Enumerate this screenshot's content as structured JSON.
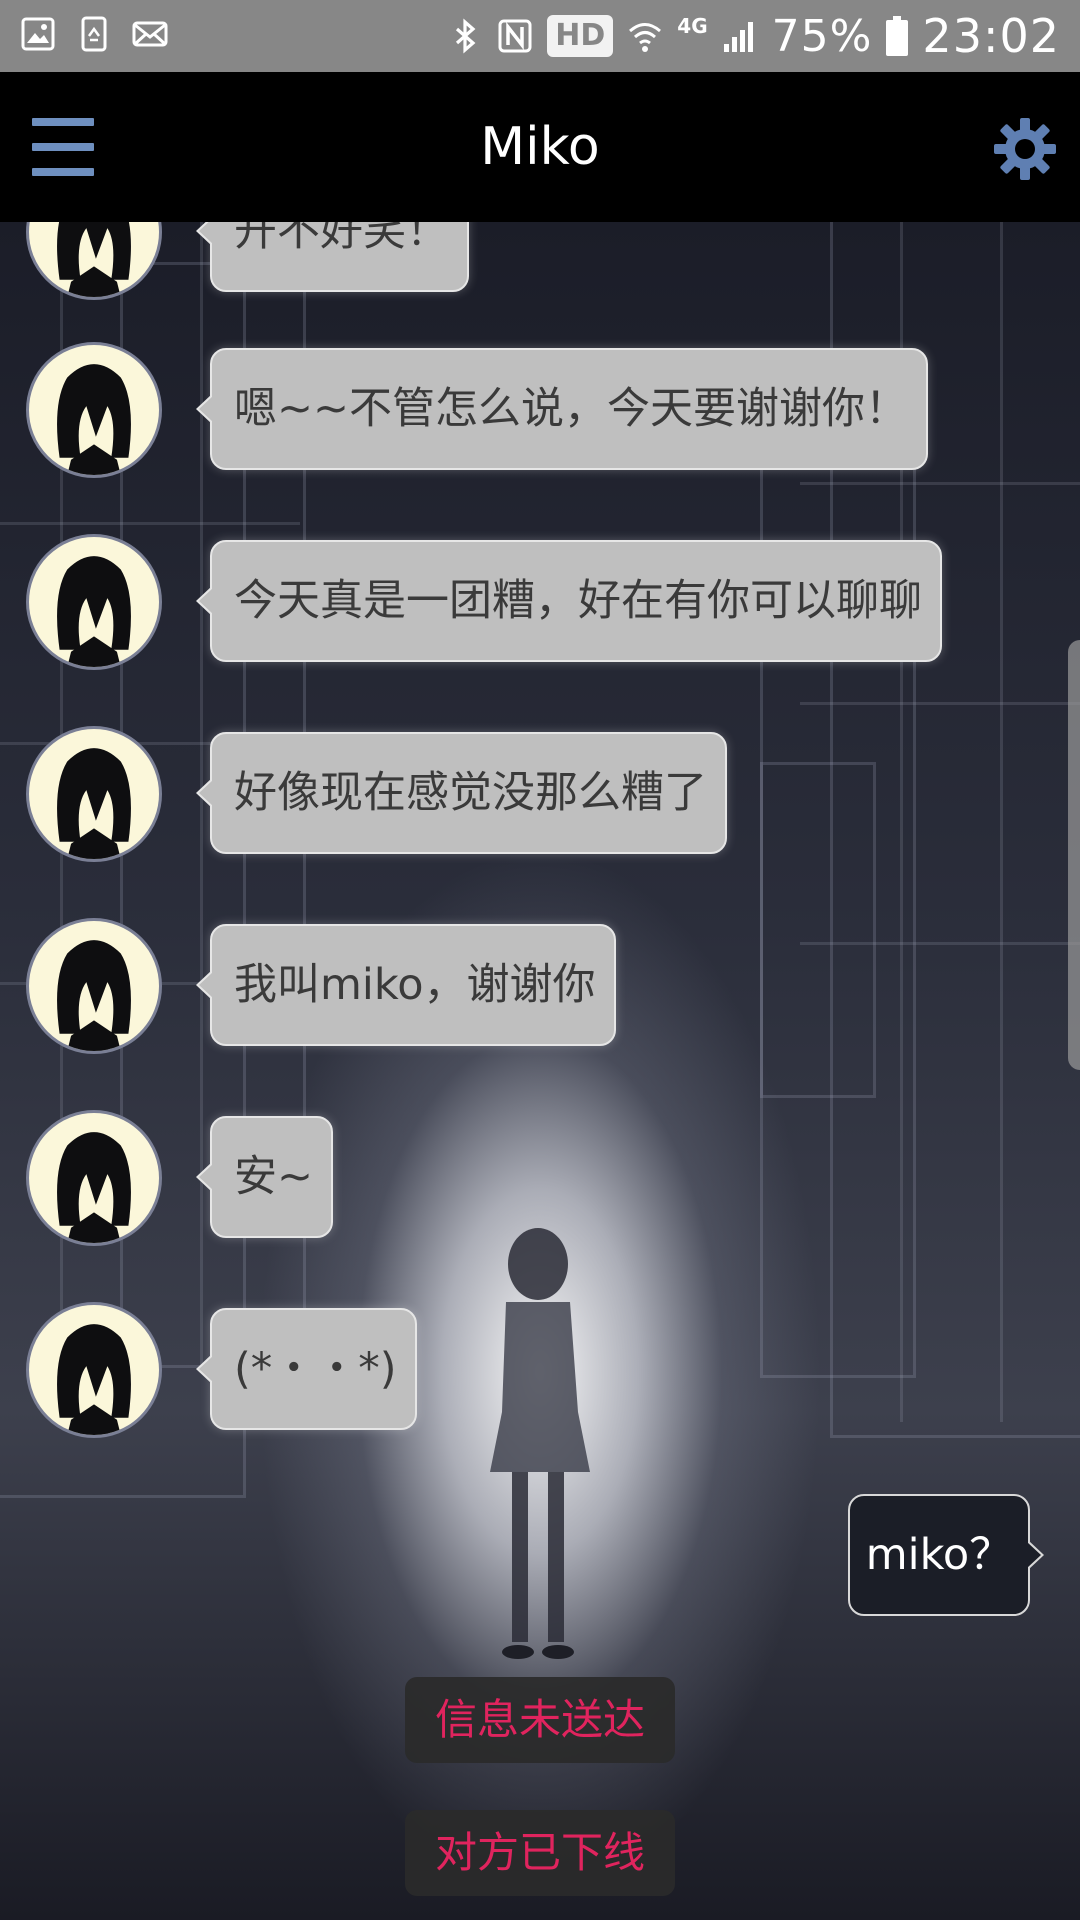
{
  "status_bar": {
    "icons_left": [
      "image-icon",
      "recycle-icon",
      "mail-icon"
    ],
    "icons_right": [
      "bluetooth-icon",
      "nfc-icon",
      "hd-badge",
      "wifi-icon",
      "4g-icon",
      "signal-icon",
      "battery-icon"
    ],
    "hd_label": "HD",
    "network": "4G",
    "battery": "75%",
    "time": "23:02"
  },
  "header": {
    "title": "Miko",
    "menu_icon": "hamburger-menu-icon",
    "settings_icon": "gear-icon"
  },
  "messages": [
    {
      "from": "miko",
      "text": "开不好笑！"
    },
    {
      "from": "miko",
      "text": "嗯~~不管怎么说，今天要谢谢你！"
    },
    {
      "from": "miko",
      "text": "今天真是一团糟，好在有你可以聊聊"
    },
    {
      "from": "miko",
      "text": "好像现在感觉没那么糟了"
    },
    {
      "from": "miko",
      "text": "我叫miko，谢谢你"
    },
    {
      "from": "miko",
      "text": "安~"
    },
    {
      "from": "miko",
      "text": "(*・・*)"
    },
    {
      "from": "me",
      "text": "miko？"
    }
  ],
  "system_notices": [
    "信息未送达",
    "对方已下线"
  ],
  "colors": {
    "status_bar": "#878787",
    "header": "#000000",
    "menu_accent": "#6e8fbf",
    "incoming_bubble": "#bfbfbf",
    "outgoing_bubble": "#1b1e27",
    "notice_text": "#e0245e"
  }
}
